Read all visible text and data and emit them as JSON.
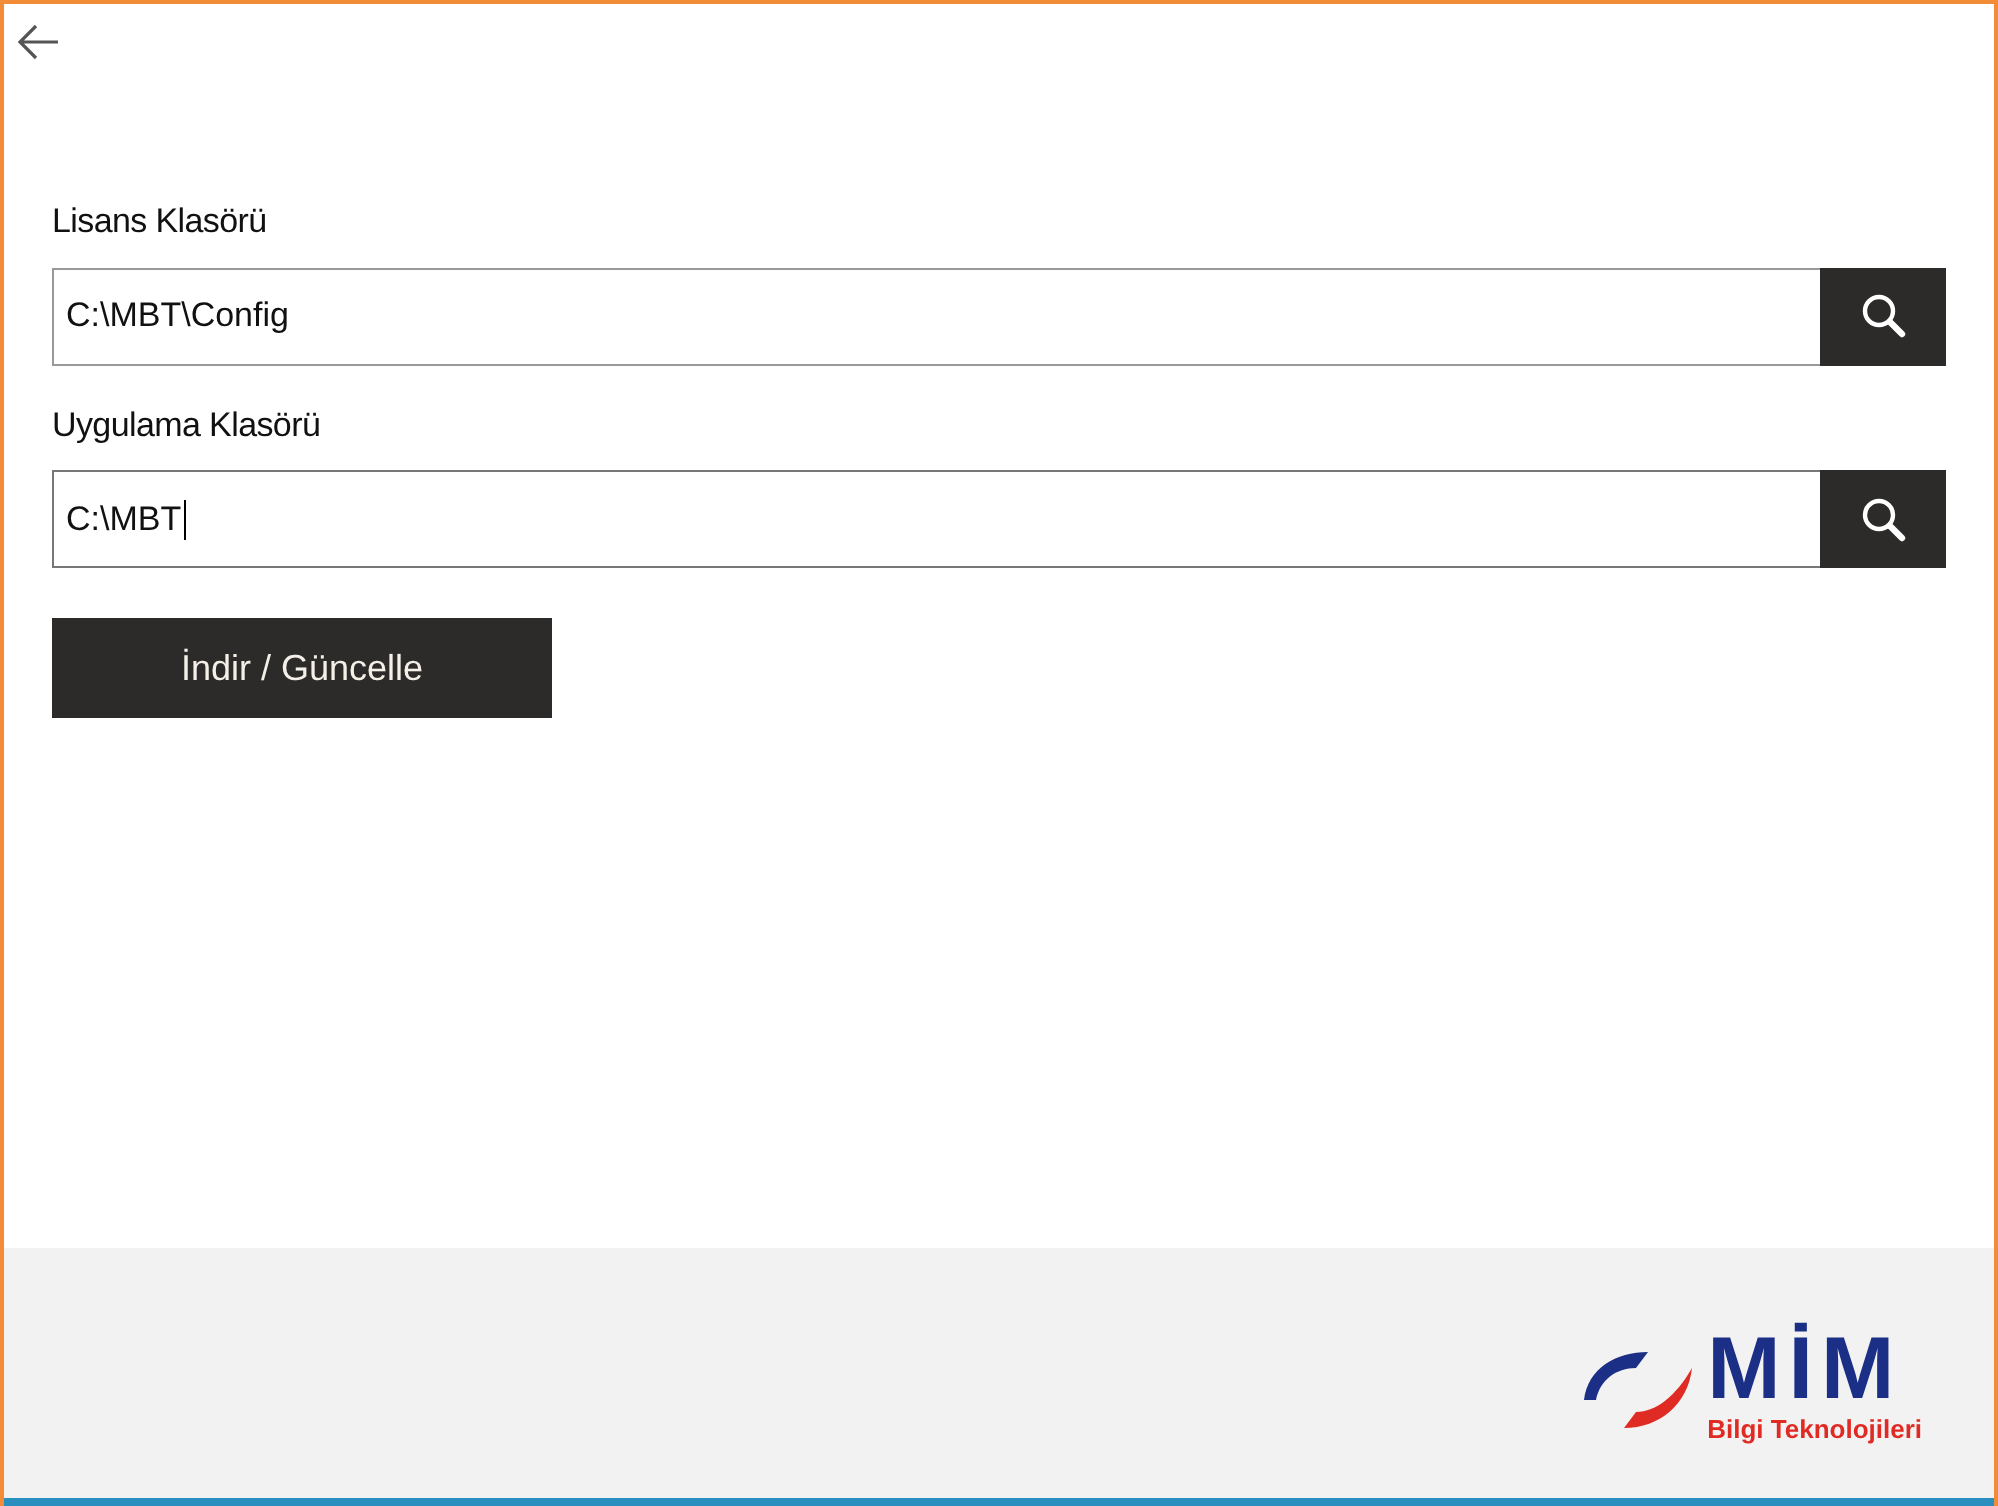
{
  "fields": [
    {
      "label": "Lisans Klasörü",
      "value": "C:\\MBT\\Config",
      "focused": false
    },
    {
      "label": "Uygulama Klasörü",
      "value": "C:\\MBT",
      "focused": true
    }
  ],
  "action_button": "İndir / Güncelle",
  "logo": {
    "name": "MİM",
    "tagline": "Bilgi Teknolojileri"
  }
}
